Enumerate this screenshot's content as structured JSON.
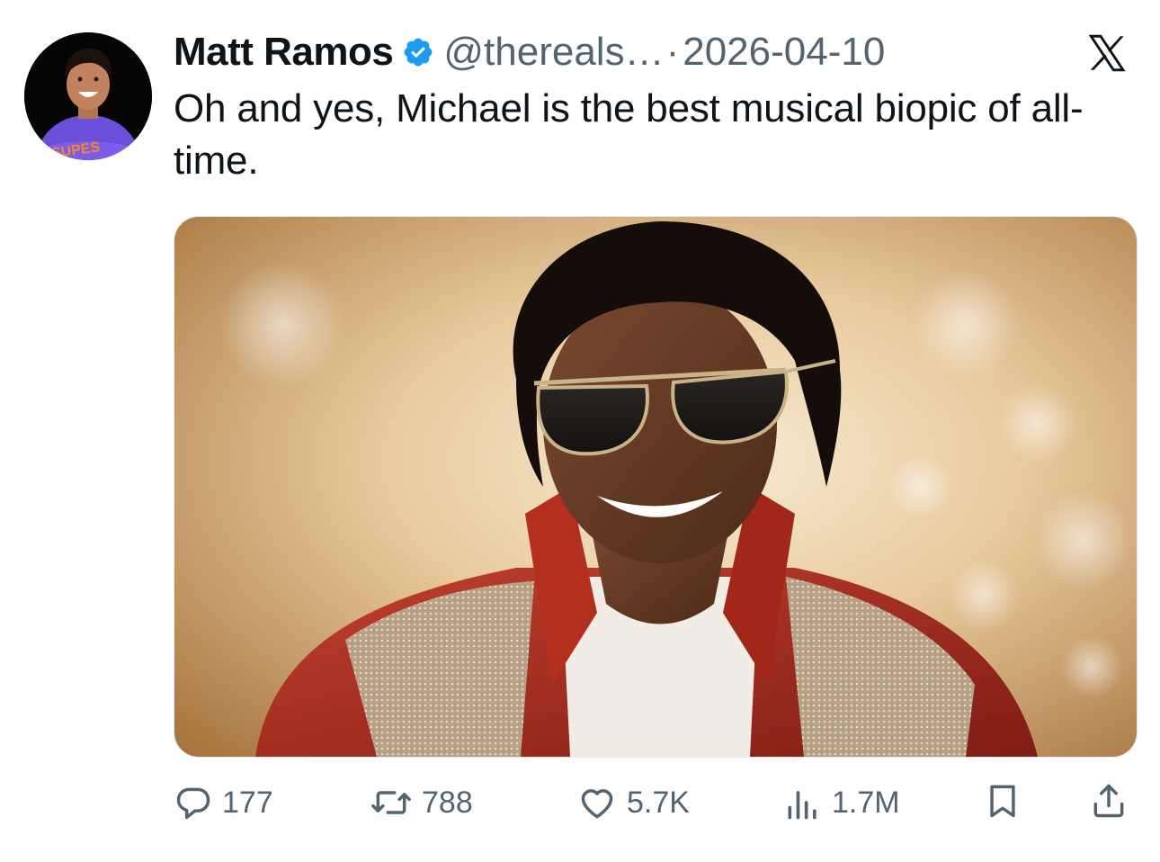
{
  "tweet": {
    "author_name": "Matt Ramos",
    "verified_icon": "verified-badge-icon",
    "handle": "@thereals…",
    "separator": "·",
    "date": "2026-04-10",
    "text": "Oh and yes, Michael is the best musical biopic of all-time.",
    "avatar_shirt_text": "SUPES"
  },
  "actions": {
    "replies": "177",
    "reposts": "788",
    "likes": "5.7K",
    "views": "1.7M"
  },
  "colors": {
    "text": "#0f1419",
    "secondary": "#536471",
    "verified": "#1d9bf0"
  }
}
